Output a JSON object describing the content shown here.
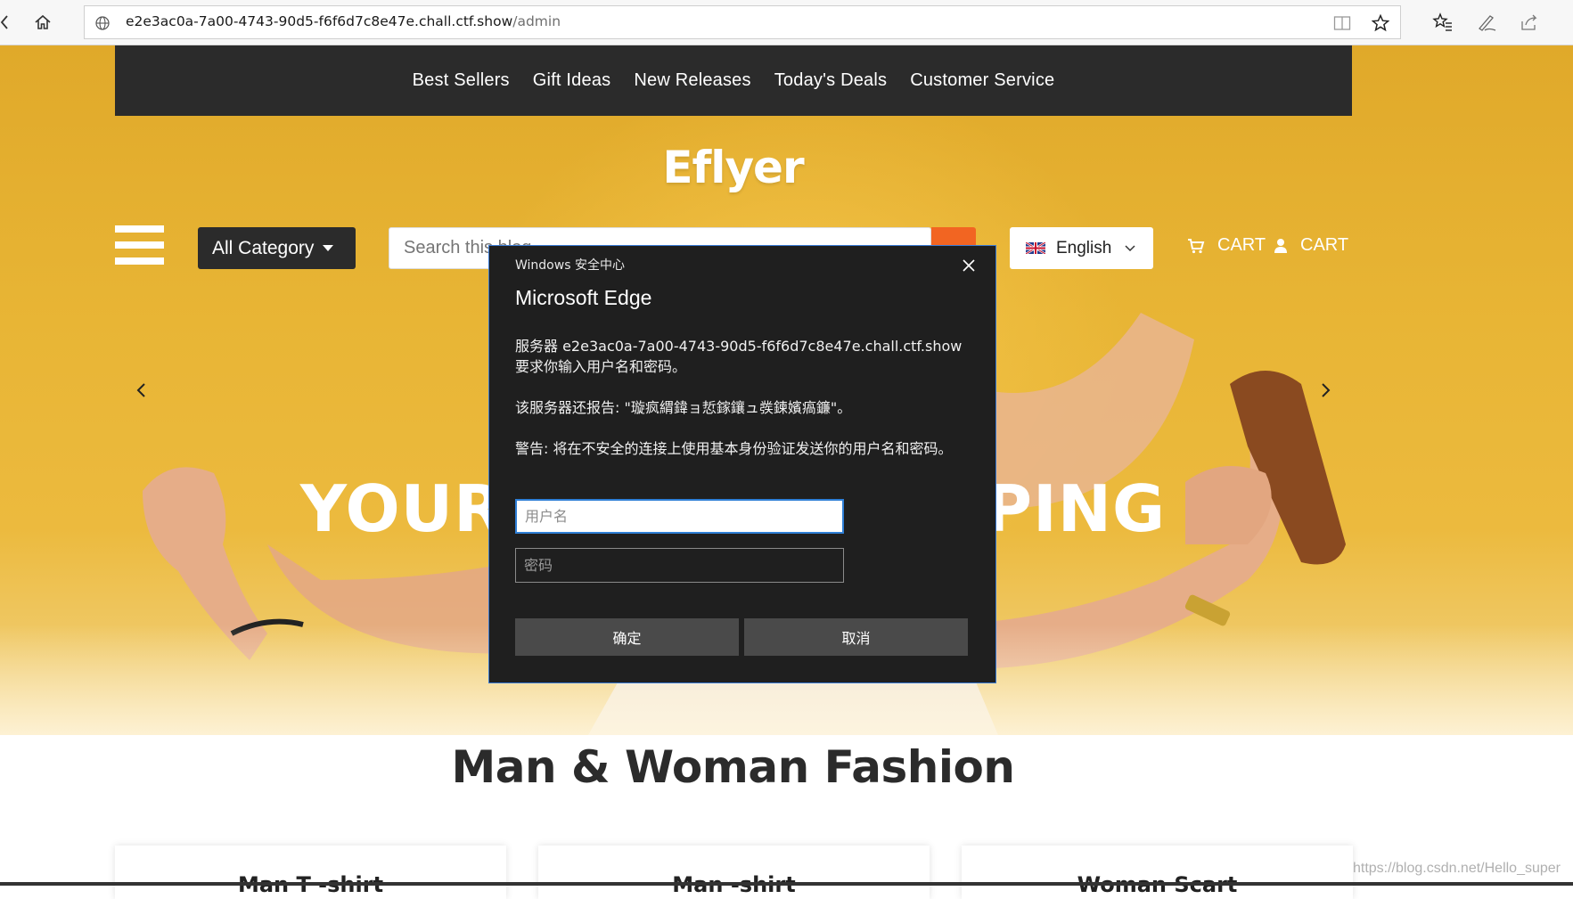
{
  "browser": {
    "url_host": "e2e3ac0a-7a00-4743-90d5-f6f6d7c8e47e.chall.ctf.show",
    "url_path": "/admin"
  },
  "site": {
    "nav": [
      "Best Sellers",
      "Gift Ideas",
      "New Releases",
      "Today's Deals",
      "Customer Service"
    ],
    "logo": "Eflyer",
    "category_label": "All Category",
    "search_placeholder": "Search this blog",
    "language": "English",
    "cart_label_1": "CART",
    "cart_label_2": "CART",
    "hero_headline": "YOUR START SHOPPING",
    "section_title": "Man & Woman Fashion",
    "cards": [
      "Man T -shirt",
      "Man -shirt",
      "Woman Scart"
    ],
    "watermark": "https://blog.csdn.net/Hello_super"
  },
  "dialog": {
    "header": "Windows 安全中心",
    "app_name": "Microsoft Edge",
    "message_1": "服务器 e2e3ac0a-7a00-4743-90d5-f6f6d7c8e47e.chall.ctf.show 要求你输入用户名和密码。",
    "message_2": "该服务器还报告: \"璇疯緭鍏ョ悊鎵鑲ュ彂鍊嬪瘑鐮\"。",
    "message_3": "警告: 将在不安全的连接上使用基本身份验证发送你的用户名和密码。",
    "username_placeholder": "用户名",
    "password_placeholder": "密码",
    "ok_label": "确定",
    "cancel_label": "取消"
  },
  "colors": {
    "hero_yellow": "#e8b535",
    "dark_bar": "#2b2b2b",
    "search_orange": "#f26522",
    "dialog_bg": "#1f1f1f",
    "dialog_border": "#3a7bd5"
  }
}
